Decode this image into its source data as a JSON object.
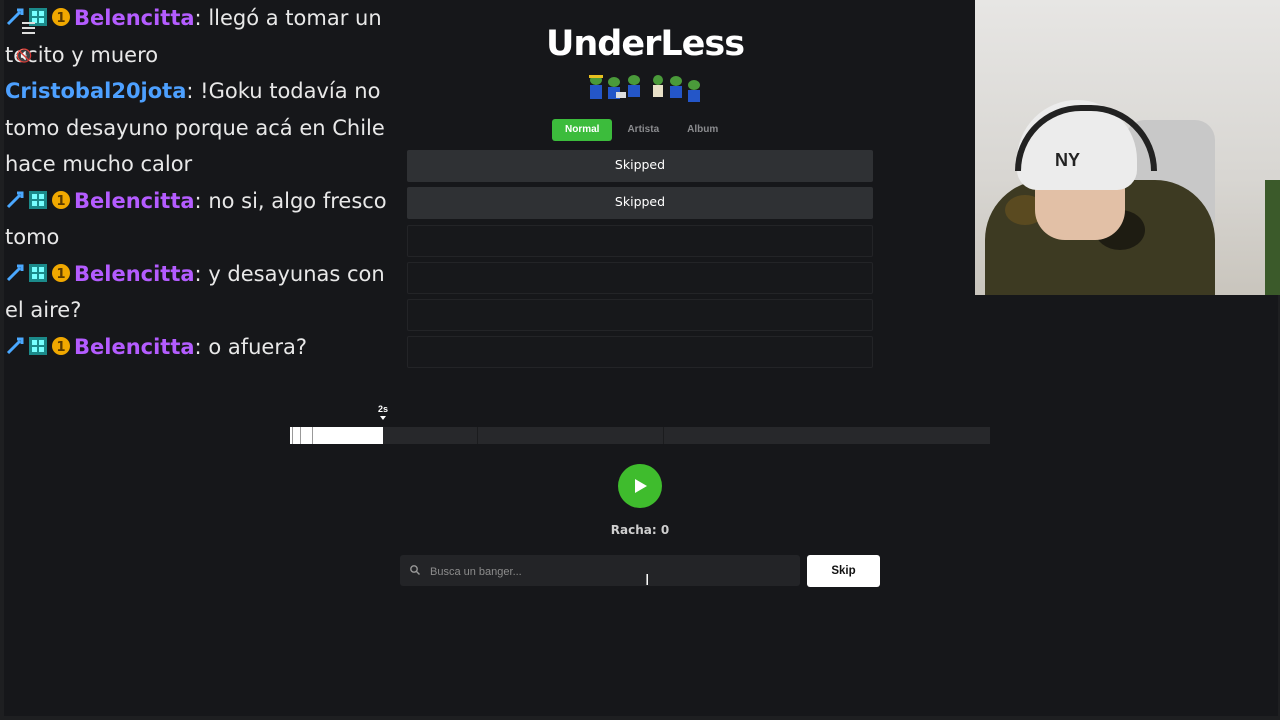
{
  "chat": {
    "messages": [
      {
        "user": "Belencitta",
        "text": "llegó a tomar un tecito y muero",
        "color": "#b45cff",
        "badges": true
      },
      {
        "user": "Cristobal20jota",
        "text": "!Goku todavía no tomo desayuno porque acá en Chile hace mucho calor",
        "color": "#4da0ff",
        "badges": false
      },
      {
        "user": "Belencitta",
        "text": "no si, algo fresco tomo",
        "color": "#b45cff",
        "badges": true
      },
      {
        "user": "Belencitta",
        "text": "y desayunas con el aire?",
        "color": "#b45cff",
        "badges": true
      },
      {
        "user": "Belencitta",
        "text": "o afuera?",
        "color": "#b45cff",
        "badges": true
      }
    ],
    "separator": ": "
  },
  "app": {
    "title": "UnderLess",
    "tabs": [
      {
        "label": "Normal",
        "active": true
      },
      {
        "label": "Artista",
        "active": false
      },
      {
        "label": "Album",
        "active": false
      }
    ],
    "slots": [
      {
        "text": "Skipped"
      },
      {
        "text": "Skipped"
      },
      {
        "text": ""
      },
      {
        "text": ""
      },
      {
        "text": ""
      },
      {
        "text": ""
      }
    ],
    "timeline": {
      "marker_label": "2s",
      "progress_fraction": 0.133
    },
    "streak_label": "Racha: 0",
    "search": {
      "placeholder": "Busca un banger..."
    },
    "skip_label": "Skip"
  },
  "colors": {
    "accent": "#3cbc3c",
    "background": "#16171a",
    "user_purple": "#b45cff",
    "user_blue": "#4da0ff"
  }
}
